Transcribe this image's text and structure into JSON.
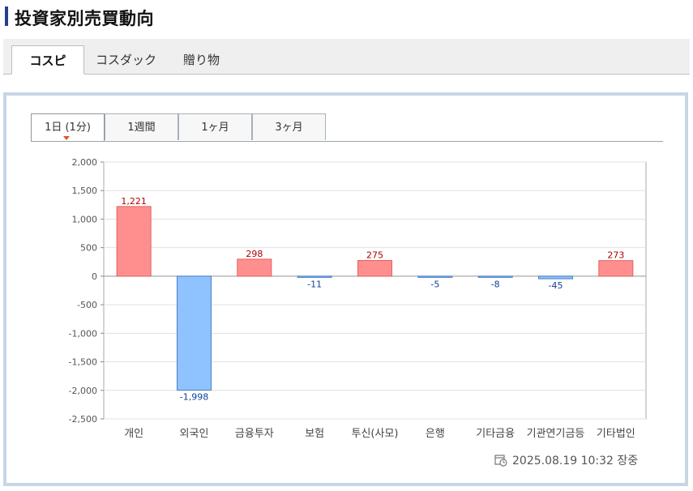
{
  "header": {
    "title": "投資家別売買動向"
  },
  "market_tabs": [
    {
      "label": "コスピ",
      "active": true
    },
    {
      "label": "コスダック",
      "active": false
    },
    {
      "label": "贈り物",
      "active": false
    }
  ],
  "period_tabs": [
    {
      "label": "1日 (1分)",
      "active": true
    },
    {
      "label": "1週間",
      "active": false
    },
    {
      "label": "1ヶ月",
      "active": false
    },
    {
      "label": "3ヶ月",
      "active": false
    }
  ],
  "chart_data": {
    "type": "bar",
    "categories": [
      "개인",
      "외국인",
      "금융투자",
      "보험",
      "투신(사모)",
      "은행",
      "기타금융",
      "기관연기금등",
      "기타법인"
    ],
    "values": [
      1221,
      -1998,
      298,
      -11,
      275,
      -5,
      -8,
      -45,
      273
    ],
    "value_labels": [
      "1,221",
      "-1,998",
      "298",
      "-11",
      "275",
      "-5",
      "-8",
      "-45",
      "273"
    ],
    "ylim": [
      -2500,
      2000
    ],
    "yticks": [
      2000,
      1500,
      1000,
      500,
      0,
      -500,
      -1000,
      -1500,
      -2000,
      -2500
    ],
    "ytick_labels": [
      "2,000",
      "1,500",
      "1,000",
      "500",
      "0",
      "-500",
      "-1,000",
      "-1,500",
      "-2,000",
      "-2,500"
    ],
    "grid": true,
    "colors": {
      "positive_fill": "#ff8f8f",
      "positive_stroke": "#e26060",
      "negative_fill": "#8fc3ff",
      "negative_stroke": "#4a7fc4",
      "positive_label": "#b00000",
      "negative_label": "#1040a0"
    }
  },
  "footer": {
    "timestamp": "2025.08.19 10:32 장중"
  },
  "icons": {
    "timestamp_icon": "calendar-clock-icon"
  }
}
